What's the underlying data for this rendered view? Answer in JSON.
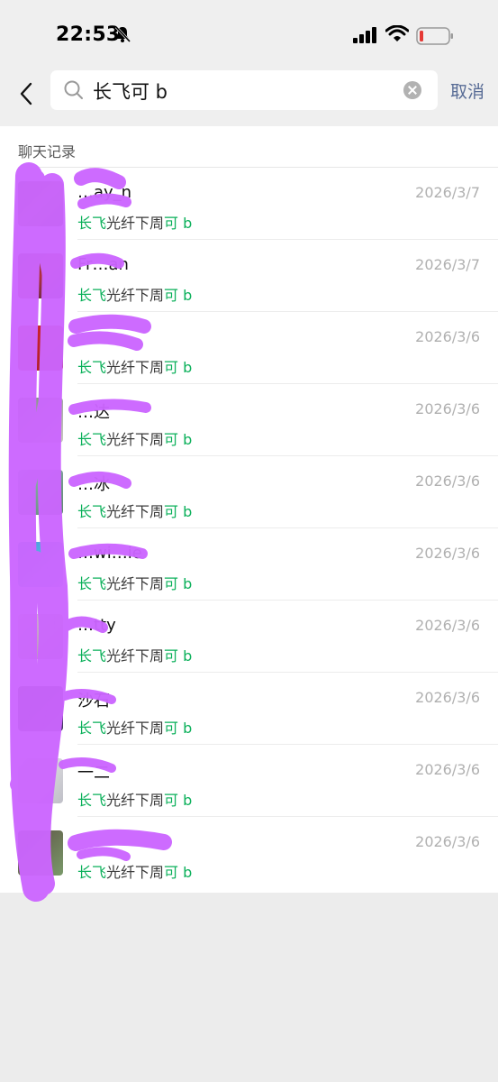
{
  "status": {
    "time": "22:53"
  },
  "search": {
    "query": "长飞可 b",
    "cancel_label": "取消"
  },
  "section_title": "聊天记录",
  "colors": {
    "highlight": "#0bb05a",
    "link": "#576b95",
    "redaction": "#cc66ff"
  },
  "results": [
    {
      "name": "…ay_n",
      "date": "2026/3/7",
      "snippet": {
        "hl1": "长飞",
        "mid": "光纤下周",
        "hl2": "可 b"
      }
    },
    {
      "name": "Fr…an",
      "date": "2026/3/7",
      "snippet": {
        "hl1": "长飞",
        "mid": "光纤下周",
        "hl2": "可 b"
      }
    },
    {
      "name": "",
      "date": "2026/3/6",
      "snippet": {
        "hl1": "长飞",
        "mid": "光纤下周",
        "hl2": "可 b"
      }
    },
    {
      "name": "…达",
      "date": "2026/3/6",
      "snippet": {
        "hl1": "长飞",
        "mid": "光纤下周",
        "hl2": "可 b"
      }
    },
    {
      "name": "…冰",
      "date": "2026/3/6",
      "snippet": {
        "hl1": "长飞",
        "mid": "光纤下周",
        "hl2": "可 b"
      }
    },
    {
      "name": "…wi…ie",
      "date": "2026/3/6",
      "snippet": {
        "hl1": "长飞",
        "mid": "光纤下周",
        "hl2": "可 b"
      }
    },
    {
      "name": "…tty",
      "date": "2026/3/6",
      "snippet": {
        "hl1": "长飞",
        "mid": "光纤下周",
        "hl2": "可 b"
      }
    },
    {
      "name": "沙石",
      "date": "2026/3/6",
      "snippet": {
        "hl1": "长飞",
        "mid": "光纤下周",
        "hl2": "可 b"
      }
    },
    {
      "name": "一二",
      "date": "2026/3/6",
      "snippet": {
        "hl1": "长飞",
        "mid": "光纤下周",
        "hl2": "可 b"
      }
    },
    {
      "name": "",
      "date": "2026/3/6",
      "snippet": {
        "hl1": "长飞",
        "mid": "光纤下周",
        "hl2": "可 b"
      }
    }
  ]
}
